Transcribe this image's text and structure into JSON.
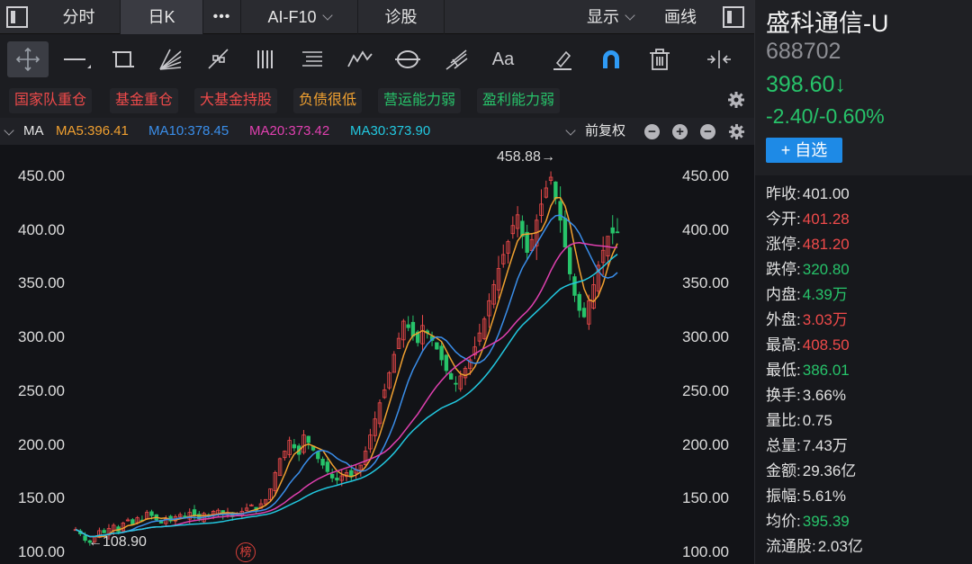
{
  "topbar": {
    "tabs": [
      "分时",
      "日K",
      "•••",
      "AI-F10",
      "诊股"
    ],
    "show_label": "显示",
    "draw_label": "画线"
  },
  "tags": [
    {
      "label": "国家队重仓",
      "color": "#ef4a4a"
    },
    {
      "label": "基金重仓",
      "color": "#ef4a4a"
    },
    {
      "label": "大基金持股",
      "color": "#ef4a4a"
    },
    {
      "label": "负债很低",
      "color": "#f0a030"
    },
    {
      "label": "营运能力弱",
      "color": "#27c36a"
    },
    {
      "label": "盈利能力弱",
      "color": "#27c36a"
    }
  ],
  "ma_row": {
    "label": "MA",
    "items": [
      {
        "text": "MA5:396.41",
        "color": "#f0a030"
      },
      {
        "text": "MA10:378.45",
        "color": "#3a8eea"
      },
      {
        "text": "MA20:373.42",
        "color": "#e040b0"
      },
      {
        "text": "MA30:373.90",
        "color": "#22c8e0"
      }
    ],
    "adjust_label": "前复权"
  },
  "chart_data": {
    "type": "candlestick",
    "y_ticks": [
      "450.00",
      "400.00",
      "350.00",
      "300.00",
      "250.00",
      "200.00",
      "150.00",
      "100.00"
    ],
    "ylim": [
      100,
      450
    ],
    "max_label": "458.88→",
    "min_label": "←108.90",
    "max_value": 458.88,
    "min_value": 108.9,
    "badge": "榜",
    "close_trend": [
      122,
      118,
      112,
      110,
      116,
      121,
      119,
      123,
      126,
      120,
      128,
      131,
      127,
      133,
      130,
      138,
      135,
      131,
      128,
      132,
      130,
      134,
      136,
      133,
      138,
      135,
      132,
      137,
      135,
      139,
      140,
      136,
      138,
      134,
      137,
      139,
      142,
      145,
      140,
      146,
      150,
      160,
      175,
      188,
      195,
      205,
      198,
      192,
      210,
      203,
      196,
      188,
      182,
      176,
      170,
      168,
      172,
      175,
      171,
      178,
      182,
      195,
      210,
      225,
      240,
      252,
      268,
      285,
      300,
      316,
      310,
      302,
      296,
      312,
      305,
      298,
      290,
      280,
      270,
      262,
      258,
      265,
      272,
      280,
      292,
      305,
      318,
      335,
      350,
      365,
      378,
      390,
      405,
      415,
      395,
      380,
      392,
      410,
      425,
      440,
      450,
      430,
      410,
      385,
      360,
      340,
      326,
      320,
      335,
      350,
      368,
      382,
      395,
      398,
      398.6
    ],
    "ma_lines": [
      {
        "name": "MA5",
        "color": "#f0a030"
      },
      {
        "name": "MA10",
        "color": "#3a8eea"
      },
      {
        "name": "MA20",
        "color": "#e040b0"
      },
      {
        "name": "MA30",
        "color": "#22c8e0"
      }
    ]
  },
  "stock": {
    "name": "盛科通信-U",
    "code": "688702",
    "price": "398.60↓",
    "change": "-2.40/-0.60%",
    "fav": "+ 自选"
  },
  "stats": [
    {
      "k": "昨收:",
      "v": "401.00",
      "color": "#e0e0e0"
    },
    {
      "k": "今开:",
      "v": "401.28",
      "color": "#ef4a4a"
    },
    {
      "k": "涨停:",
      "v": "481.20",
      "color": "#ef4a4a"
    },
    {
      "k": "跌停:",
      "v": "320.80",
      "color": "#27c36a"
    },
    {
      "k": "内盘:",
      "v": "4.39万",
      "color": "#27c36a"
    },
    {
      "k": "外盘:",
      "v": "3.03万",
      "color": "#ef4a4a"
    },
    {
      "k": "最高:",
      "v": "408.50",
      "color": "#ef4a4a"
    },
    {
      "k": "最低:",
      "v": "386.01",
      "color": "#27c36a"
    },
    {
      "k": "换手:",
      "v": "3.66%",
      "color": "#e0e0e0"
    },
    {
      "k": "量比:",
      "v": "0.75",
      "color": "#e0e0e0"
    },
    {
      "k": "总量:",
      "v": "7.43万",
      "color": "#e0e0e0"
    },
    {
      "k": "金额:",
      "v": "29.36亿",
      "color": "#e0e0e0"
    },
    {
      "k": "振幅:",
      "v": "5.61%",
      "color": "#e0e0e0"
    },
    {
      "k": "均价:",
      "v": "395.39",
      "color": "#27c36a"
    },
    {
      "k": "流通股:",
      "v": "2.03亿",
      "color": "#e0e0e0"
    }
  ]
}
